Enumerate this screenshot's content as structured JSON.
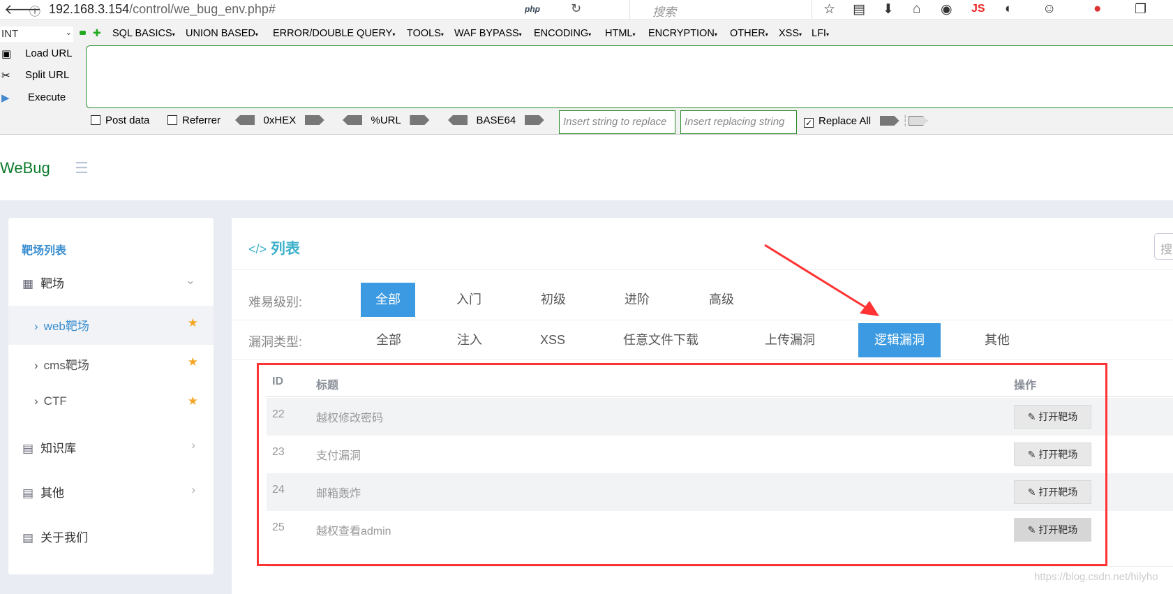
{
  "browser": {
    "url_host": "192.168.3.154",
    "url_path": "/control/we_bug_env.php#",
    "search_placeholder": "搜索",
    "php_label": "php",
    "js_label": "JS"
  },
  "hackbar": {
    "select_value": "INT",
    "menus": [
      "SQL BASICS",
      "UNION BASED",
      "ERROR/DOUBLE QUERY",
      "TOOLS",
      "WAF BYPASS",
      "ENCODING",
      "HTML",
      "ENCRYPTION",
      "OTHER",
      "XSS",
      "LFI"
    ],
    "load_url": "Load URL",
    "split_url": "Split URL",
    "execute": "Execute",
    "url_value": "",
    "post_data": "Post data",
    "referrer": "Referrer",
    "hex": "0xHEX",
    "url_enc": "%URL",
    "base64": "BASE64",
    "insert_placeholder": "Insert string to replace",
    "replacing_placeholder": "Insert replacing string",
    "replace_all": "Replace All",
    "replace_all_checked": true
  },
  "app": {
    "logo": "WeBug"
  },
  "sidebar": {
    "heading": "靶场列表",
    "items": [
      {
        "label": "靶场"
      },
      {
        "label": "web靶场"
      },
      {
        "label": "cms靶场"
      },
      {
        "label": "CTF"
      },
      {
        "label": "知识库"
      },
      {
        "label": "其他"
      },
      {
        "label": "关于我们"
      }
    ]
  },
  "main": {
    "title": "列表",
    "search_placeholder": "搜",
    "difficulty_label": "难易级别:",
    "difficulty": [
      "全部",
      "入门",
      "初级",
      "进阶",
      "高级"
    ],
    "type_label": "漏洞类型:",
    "types": [
      "全部",
      "注入",
      "XSS",
      "任意文件下载",
      "上传漏洞",
      "逻辑漏洞",
      "其他"
    ],
    "table": {
      "headers": [
        "ID",
        "标题",
        "操作"
      ],
      "rows": [
        {
          "id": "22",
          "title": "越权修改密码",
          "action": "打开靶场"
        },
        {
          "id": "23",
          "title": "支付漏洞",
          "action": "打开靶场"
        },
        {
          "id": "24",
          "title": "邮箱轰炸",
          "action": "打开靶场"
        },
        {
          "id": "25",
          "title": "越权查看admin",
          "action": "打开靶场"
        }
      ]
    }
  },
  "watermark": "https://blog.csdn.net/hilyho",
  "colors": {
    "accent": "#3b9ae1",
    "annotation": "#ff3333",
    "logo": "#0a7a2a",
    "star": "#f5a623"
  }
}
